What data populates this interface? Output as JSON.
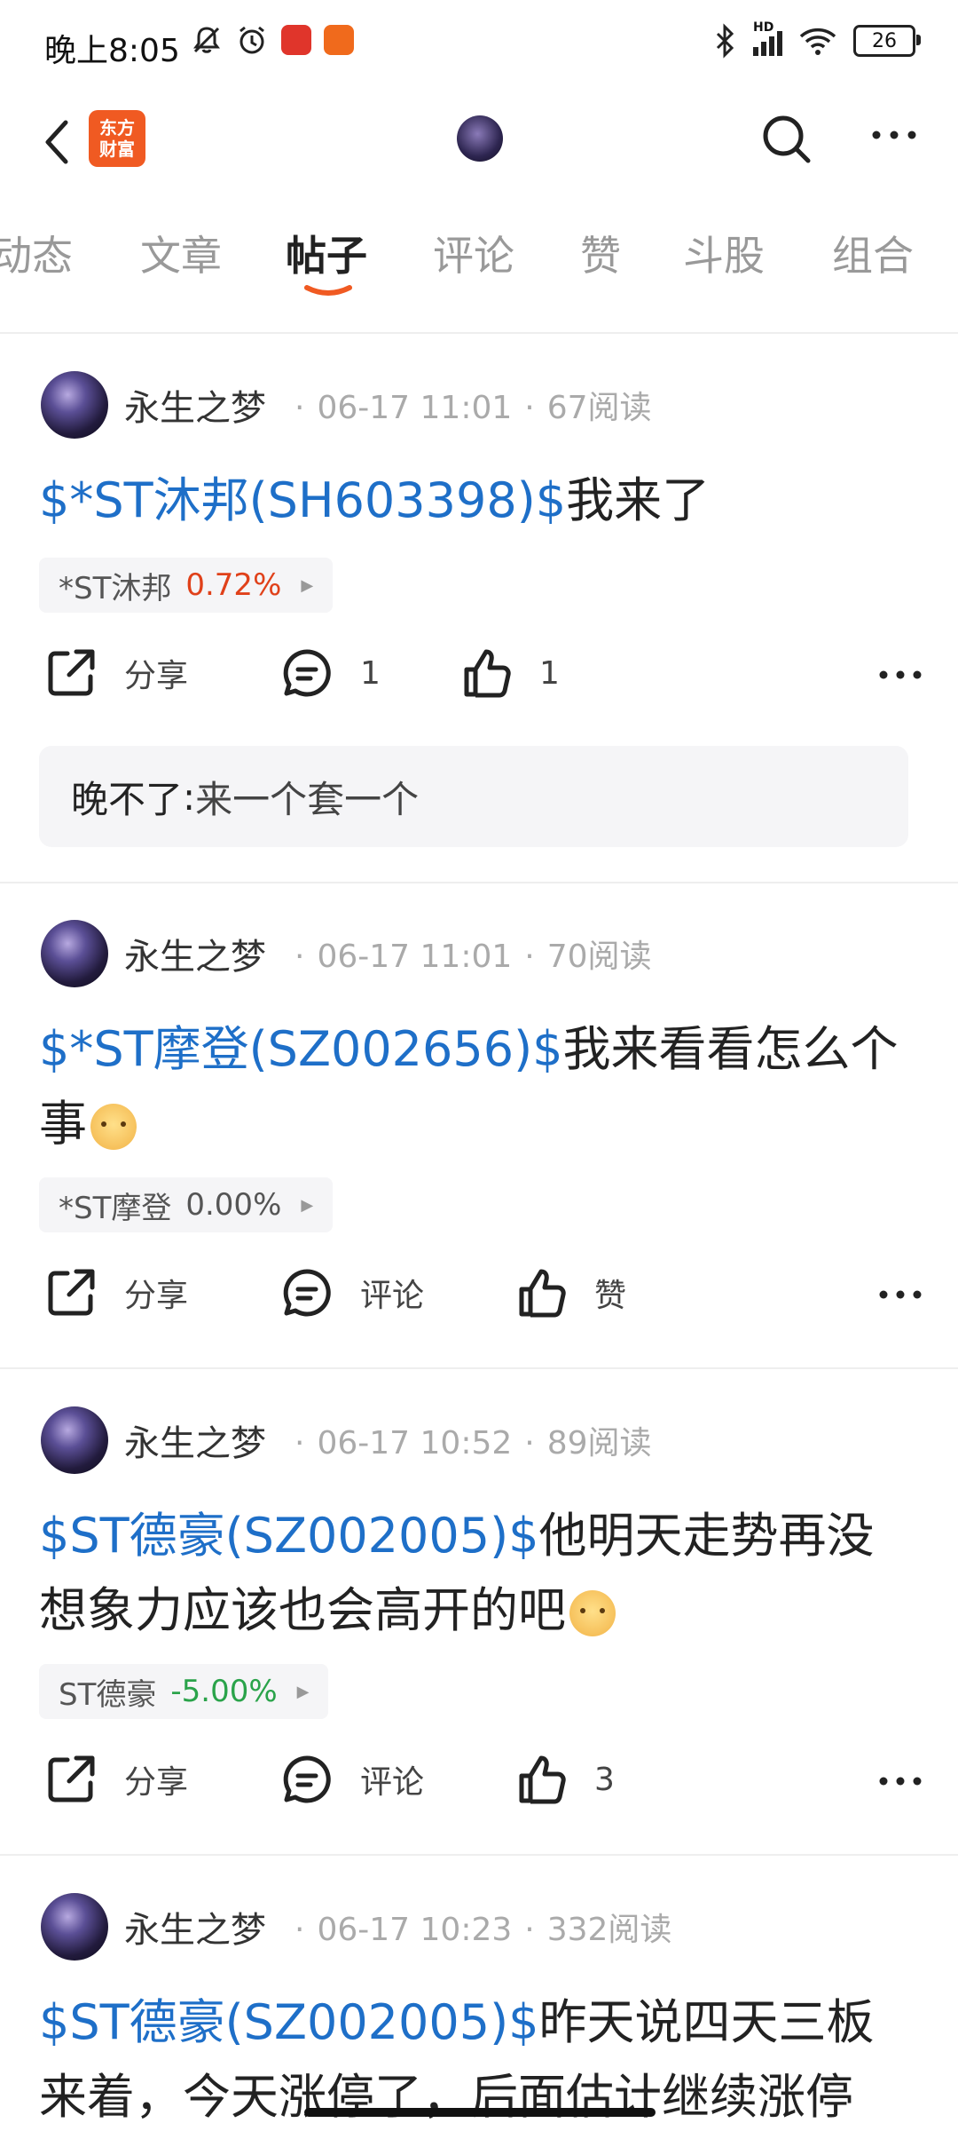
{
  "status": {
    "time": "晚上8:05",
    "battery": "26",
    "network": "HD"
  },
  "header": {
    "logo_line1": "东方",
    "logo_line2": "财富"
  },
  "tabs": [
    {
      "label": "动态"
    },
    {
      "label": "文章"
    },
    {
      "label": "帖子"
    },
    {
      "label": "评论"
    },
    {
      "label": "赞"
    },
    {
      "label": "斗股"
    },
    {
      "label": "组合"
    }
  ],
  "posts": [
    {
      "author": "永生之梦",
      "time": "06-17 11:01",
      "reads": "67阅读",
      "ticker": "$*ST沐邦(SH603398)$",
      "text": "我来了",
      "text2": "",
      "stock_name": "*ST沐邦",
      "stock_pct": "0.72%",
      "share_label": "分享",
      "comment_label": "1",
      "like_label": "1",
      "comment": {
        "user": "晚不了",
        "sep": ": ",
        "text": "来一个套一个"
      }
    },
    {
      "author": "永生之梦",
      "time": "06-17 11:01",
      "reads": "70阅读",
      "ticker": "$*ST摩登(SZ002656)$",
      "text": "我来看看怎么个",
      "text2": "事",
      "stock_name": "*ST摩登",
      "stock_pct": "0.00%",
      "share_label": "分享",
      "comment_label": "评论",
      "like_label": "赞"
    },
    {
      "author": "永生之梦",
      "time": "06-17 10:52",
      "reads": "89阅读",
      "ticker": "$ST德豪(SZ002005)$",
      "text": "他明天走势再没",
      "text2": "想象力应该也会高开的吧",
      "stock_name": "ST德豪",
      "stock_pct": "-5.00%",
      "share_label": "分享",
      "comment_label": "评论",
      "like_label": "3"
    },
    {
      "author": "永生之梦",
      "time": "06-17 10:23",
      "reads": "332阅读",
      "ticker": "$ST德豪(SZ002005)$",
      "text": "昨天说四天三板",
      "text2": "来着，今天涨停了，后面估计继续涨停"
    }
  ],
  "colors": {
    "ticker": "#1e6fc8",
    "up": "#e0411a",
    "down": "#2aa34a",
    "flat": "#555555",
    "accent": "#f05a22"
  }
}
